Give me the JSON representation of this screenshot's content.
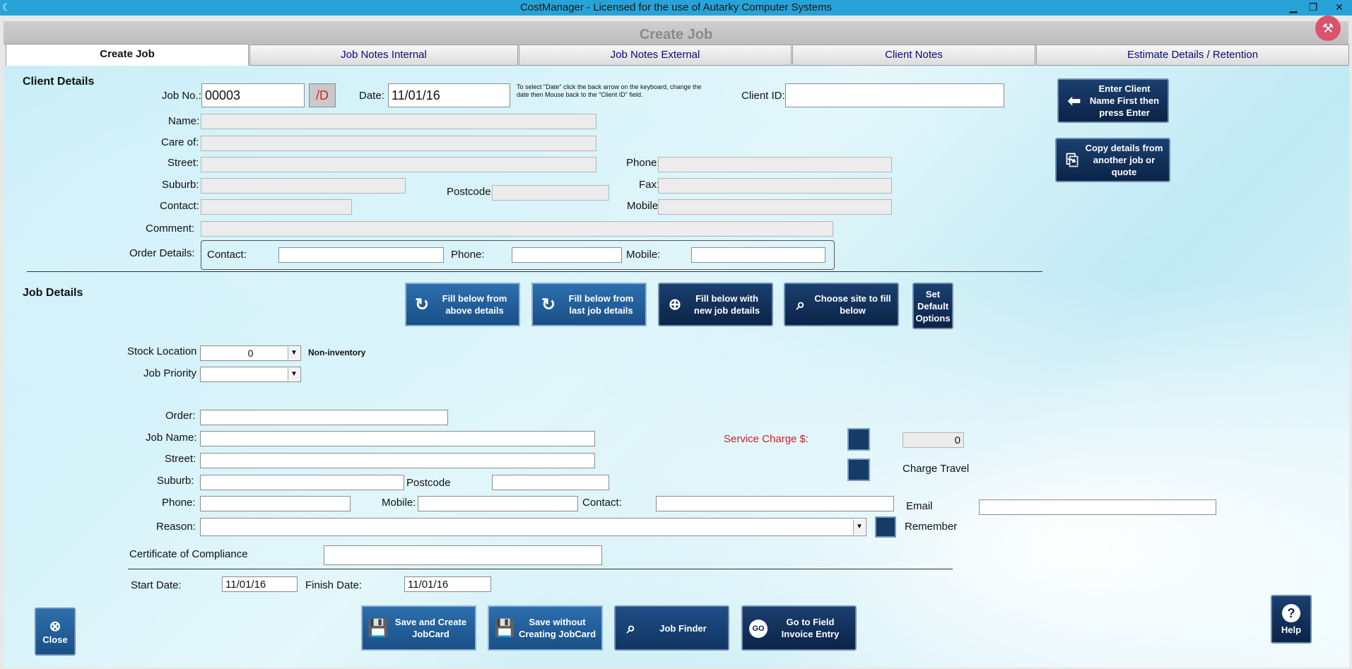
{
  "window": {
    "title": "CostManager - Licensed for the use of Autarky Computer Systems",
    "minimize": "▁",
    "restore": "❐",
    "close": "✕"
  },
  "page_title": "Create Job",
  "tabs": [
    {
      "label": "Create Job",
      "active": true
    },
    {
      "label": "Job Notes Internal"
    },
    {
      "label": "Job Notes External"
    },
    {
      "label": "Client Notes"
    },
    {
      "label": "Estimate Details / Retention"
    }
  ],
  "client": {
    "section": "Client Details",
    "job_no_label": "Job No.:",
    "job_no": "00003",
    "d_button": "/D",
    "date_label": "Date:",
    "date": "11/01/16",
    "date_hint": "To select \"Date\" click the back arrow on the keyboard, change the date then Mouse back to the \"Client ID\" field.",
    "client_id_label": "Client ID:",
    "client_id": "",
    "name_label": "Name:",
    "care_of_label": "Care of:",
    "street_label": "Street:",
    "phone_label": "Phone:",
    "suburb_label": "Suburb:",
    "postcode_label": "Postcode",
    "fax_label": "Fax:",
    "contact_label": "Contact:",
    "mobile_label": "Mobile:",
    "comment_label": "Comment:",
    "order_details_label": "Order Details:",
    "od_contact_label": "Contact:",
    "od_phone_label": "Phone:",
    "od_mobile_label": "Mobile:",
    "enter_client_btn": "Enter Client Name First then press Enter",
    "copy_details_btn": "Copy details from another job or quote"
  },
  "job": {
    "section": "Job Details",
    "fill_above_btn": "Fill below from above details",
    "fill_last_btn": "Fill below from last job  details",
    "fill_new_btn": "Fill below with new job  details",
    "choose_site_btn": "Choose site to fill below",
    "set_default_btn": "Set Default Options",
    "stock_location_label": "Stock Location",
    "stock_location_value": "0",
    "non_inventory": "Non-inventory",
    "job_priority_label": "Job Priority",
    "job_priority_value": "",
    "order_label": "Order:",
    "job_name_label": "Job Name:",
    "street_label": "Street:",
    "suburb_label": "Suburb:",
    "postcode_label": "Postcode",
    "phone_label": "Phone:",
    "mobile_label": "Mobile:",
    "contact_label": "Contact:",
    "email_label": "Email",
    "reason_label": "Reason:",
    "remember_label": "Remember",
    "service_charge_label": "Service Charge $:",
    "service_charge_value": "0",
    "charge_travel_label": "Charge Travel",
    "cert_label": "Certificate of Compliance",
    "start_date_label": "Start Date:",
    "start_date": "11/01/16",
    "finish_date_label": "Finish Date:",
    "finish_date": "11/01/16"
  },
  "footer": {
    "close": "Close",
    "save_create": "Save and Create JobCard",
    "save_without": "Save without Creating JobCard",
    "job_finder": "Job Finder",
    "go_field": "Go to Field Invoice Entry",
    "go_icon": "GO",
    "help": "Help"
  },
  "colors": {
    "title_bar": "#28a3d8",
    "navy_button": "#0b2447",
    "blue_button": "#1a4f86",
    "service_charge_text": "#d0202a",
    "d_button_text": "#e02020"
  }
}
